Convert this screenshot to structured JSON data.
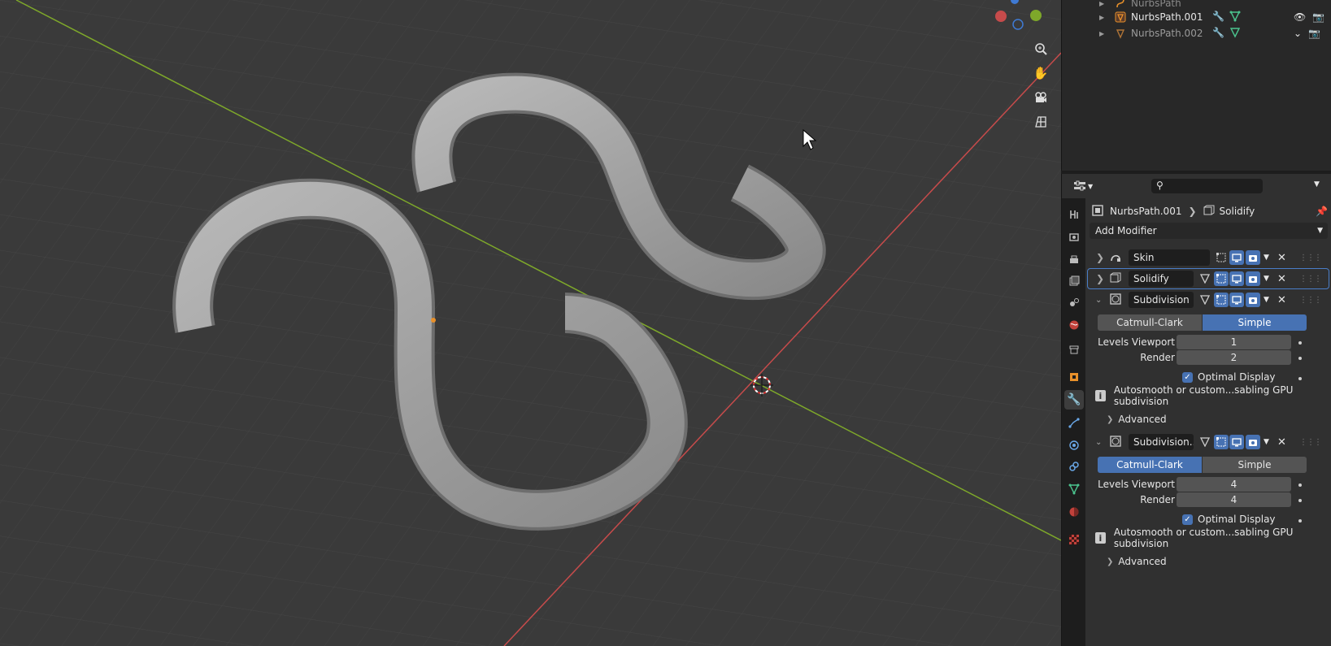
{
  "outliner": {
    "rows": [
      {
        "name": "NurbsPath"
      },
      {
        "name": "NurbsPath.001"
      },
      {
        "name": "NurbsPath.002"
      }
    ]
  },
  "properties": {
    "search_placeholder": "",
    "breadcrumb": {
      "object": "NurbsPath.001",
      "modifier": "Solidify"
    },
    "add_modifier": "Add Modifier",
    "modifiers": [
      {
        "name": "Skin"
      },
      {
        "name": "Solidify"
      },
      {
        "name": "Subdivision",
        "mode_options": [
          "Catmull-Clark",
          "Simple"
        ],
        "selected_mode": "Simple",
        "levels_viewport_label": "Levels Viewport",
        "levels_viewport": "1",
        "render_label": "Render",
        "render": "2",
        "optimal_display_label": "Optimal Display",
        "message": "Autosmooth or custom...sabling GPU subdivision",
        "advanced_label": "Advanced"
      },
      {
        "name": "Subdivision....",
        "mode_options": [
          "Catmull-Clark",
          "Simple"
        ],
        "selected_mode": "Catmull-Clark",
        "levels_viewport_label": "Levels Viewport",
        "levels_viewport": "4",
        "render_label": "Render",
        "render": "4",
        "optimal_display_label": "Optimal Display",
        "message": "Autosmooth or custom...sabling GPU subdivision",
        "advanced_label": "Advanced"
      }
    ]
  },
  "colors": {
    "accent": "#4772b3",
    "x_axis": "#c64b4b",
    "y_axis": "#7ea82a",
    "object_orange": "#e8902a",
    "modifier_blue": "#6aa8e8",
    "data_green": "#4bc48e"
  },
  "icons": {
    "viewport_tools": [
      "zoom-icon",
      "hand-pan-icon",
      "camera-icon",
      "grid-ortho-icon"
    ],
    "property_tabs": [
      "tool-icon",
      "render-icon",
      "output-icon",
      "view-layer-icon",
      "scene-icon",
      "world-icon",
      "collection-icon",
      "object-icon",
      "modifier-icon",
      "particles-icon",
      "physics-icon",
      "constraints-icon",
      "data-icon",
      "material-icon",
      "texture-icon"
    ]
  }
}
